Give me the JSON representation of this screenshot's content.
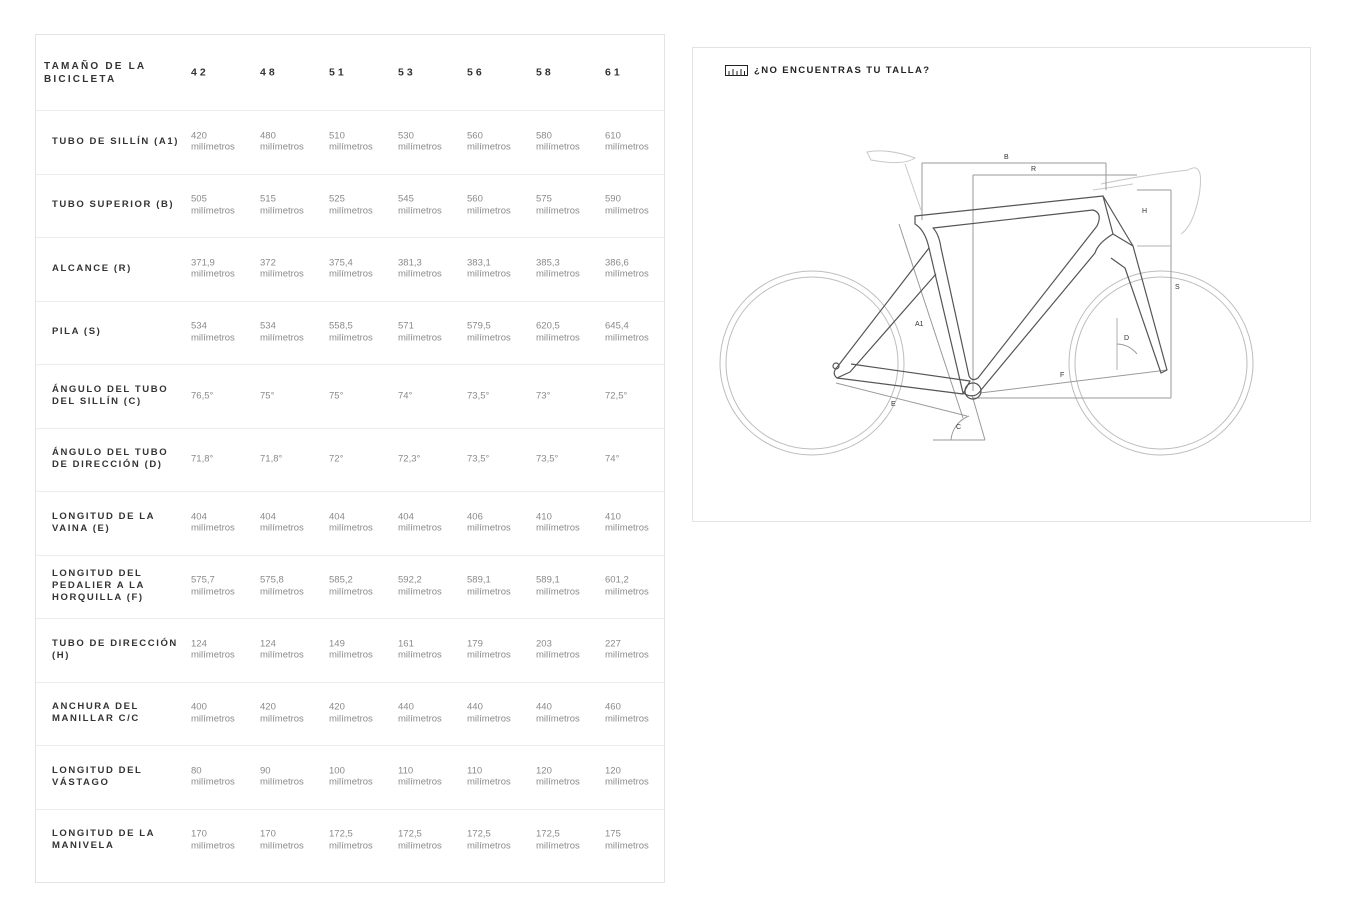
{
  "table": {
    "header_label": "TAMAÑO DE LA BICICLETA",
    "sizes": [
      "42",
      "48",
      "51",
      "53",
      "56",
      "58",
      "61"
    ],
    "unit": "milímetros",
    "rows": [
      {
        "label": "TUBO DE SILLÍN (A1)",
        "values": [
          "420",
          "480",
          "510",
          "530",
          "560",
          "580",
          "610"
        ],
        "has_unit": true
      },
      {
        "label": "TUBO SUPERIOR (B)",
        "values": [
          "505",
          "515",
          "525",
          "545",
          "560",
          "575",
          "590"
        ],
        "has_unit": true
      },
      {
        "label": "ALCANCE (R)",
        "values": [
          "371,9",
          "372",
          "375,4",
          "381,3",
          "383,1",
          "385,3",
          "386,6"
        ],
        "has_unit": true
      },
      {
        "label": "PILA (S)",
        "values": [
          "534",
          "534",
          "558,5",
          "571",
          "579,5",
          "620,5",
          "645,4"
        ],
        "has_unit": true
      },
      {
        "label": "ÁNGULO DEL TUBO DEL SILLÍN (C)",
        "values": [
          "76,5°",
          "75°",
          "75°",
          "74°",
          "73,5°",
          "73°",
          "72,5°"
        ],
        "has_unit": false
      },
      {
        "label": "ÁNGULO DEL TUBO DE DIRECCIÓN (D)",
        "values": [
          "71,8°",
          "71,8°",
          "72°",
          "72,3°",
          "73,5°",
          "73,5°",
          "74°"
        ],
        "has_unit": false
      },
      {
        "label": "LONGITUD DE LA VAINA (E)",
        "values": [
          "404",
          "404",
          "404",
          "404",
          "406",
          "410",
          "410"
        ],
        "has_unit": true
      },
      {
        "label": "LONGITUD DEL PEDALIER A LA HORQUILLA (F)",
        "values": [
          "575,7",
          "575,8",
          "585,2",
          "592,2",
          "589,1",
          "589,1",
          "601,2"
        ],
        "has_unit": true
      },
      {
        "label": "TUBO DE DIRECCIÓN (H)",
        "values": [
          "124",
          "124",
          "149",
          "161",
          "179",
          "203",
          "227"
        ],
        "has_unit": true
      },
      {
        "label": "ANCHURA DEL MANILLAR C/C",
        "values": [
          "400",
          "420",
          "420",
          "440",
          "440",
          "440",
          "460"
        ],
        "has_unit": true
      },
      {
        "label": "LONGITUD DEL VÁSTAGO",
        "values": [
          "80",
          "90",
          "100",
          "110",
          "110",
          "120",
          "120"
        ],
        "has_unit": true
      },
      {
        "label": "LONGITUD DE LA MANIVELA",
        "values": [
          "170",
          "170",
          "172,5",
          "172,5",
          "172,5",
          "172,5",
          "175"
        ],
        "has_unit": true
      }
    ]
  },
  "size_finder": {
    "label": "¿NO ENCUENTRAS TU TALLA?",
    "icon": "ruler-icon"
  },
  "diagram": {
    "labels": {
      "B": "B",
      "R": "R",
      "H": "H",
      "S": "S",
      "A1": "A1",
      "D": "D",
      "F": "F",
      "E": "E",
      "C": "C"
    }
  }
}
